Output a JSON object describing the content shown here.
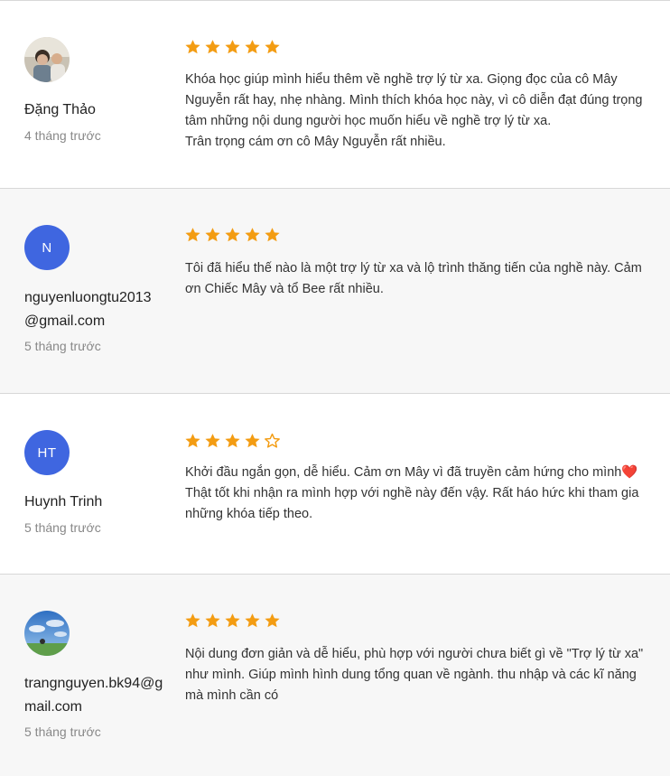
{
  "colors": {
    "star": "#f39c12",
    "avatar_initials_bg": "#3f66e0",
    "divider": "#d8d8d8"
  },
  "reviews": [
    {
      "avatar_type": "photo",
      "avatar_icon": "user-photo-child",
      "name_lines": [
        "Đặng Thảo"
      ],
      "time": "4 tháng trước",
      "rating": 5,
      "text_lines": [
        "Khóa học giúp mình hiểu thêm về nghề trợ lý từ xa. Giọng đọc của cô Mây Nguyễn rất hay, nhẹ nhàng. Mình thích khóa học này, vì cô diễn đạt đúng trọng tâm những nội dung người học muốn hiểu về nghề trợ lý từ xa.",
        "Trân trọng cám ơn cô Mây Nguyễn rất nhiều."
      ]
    },
    {
      "avatar_type": "initials",
      "initials": "N",
      "name_lines": [
        "nguyenluongtu2013",
        "@gmail.com"
      ],
      "time": "5 tháng trước",
      "rating": 5,
      "text_lines": [
        "Tôi đã hiểu thế nào là một trợ lý từ xa và lộ trình thăng tiến của nghề này. Cảm ơn Chiếc Mây và tổ Bee rất nhiều."
      ]
    },
    {
      "avatar_type": "initials",
      "initials": "HT",
      "name_lines": [
        "Huynh Trinh"
      ],
      "time": "5 tháng trước",
      "rating": 4,
      "text_before_heart": "Khởi đầu ngắn gọn, dễ hiểu. Cảm ơn Mây vì đã truyền cảm hứng cho mình",
      "heart": "❤️",
      "text_after_heart": " Thật tốt khi nhận ra mình hợp với nghề này đến vậy. Rất háo hức khi tham gia những khóa tiếp theo."
    },
    {
      "avatar_type": "photo",
      "avatar_icon": "user-photo-sky",
      "name_lines": [
        "trangnguyen.bk94@g",
        "mail.com"
      ],
      "time": "5 tháng trước",
      "rating": 5,
      "text_lines": [
        "Nội dung đơn giản và dễ hiểu, phù hợp với người chưa biết gì về \"Trợ lý từ xa\" như mình. Giúp mình hình dung tổng quan về ngành. thu nhập và các kĩ năng mà mình cần có"
      ]
    }
  ]
}
